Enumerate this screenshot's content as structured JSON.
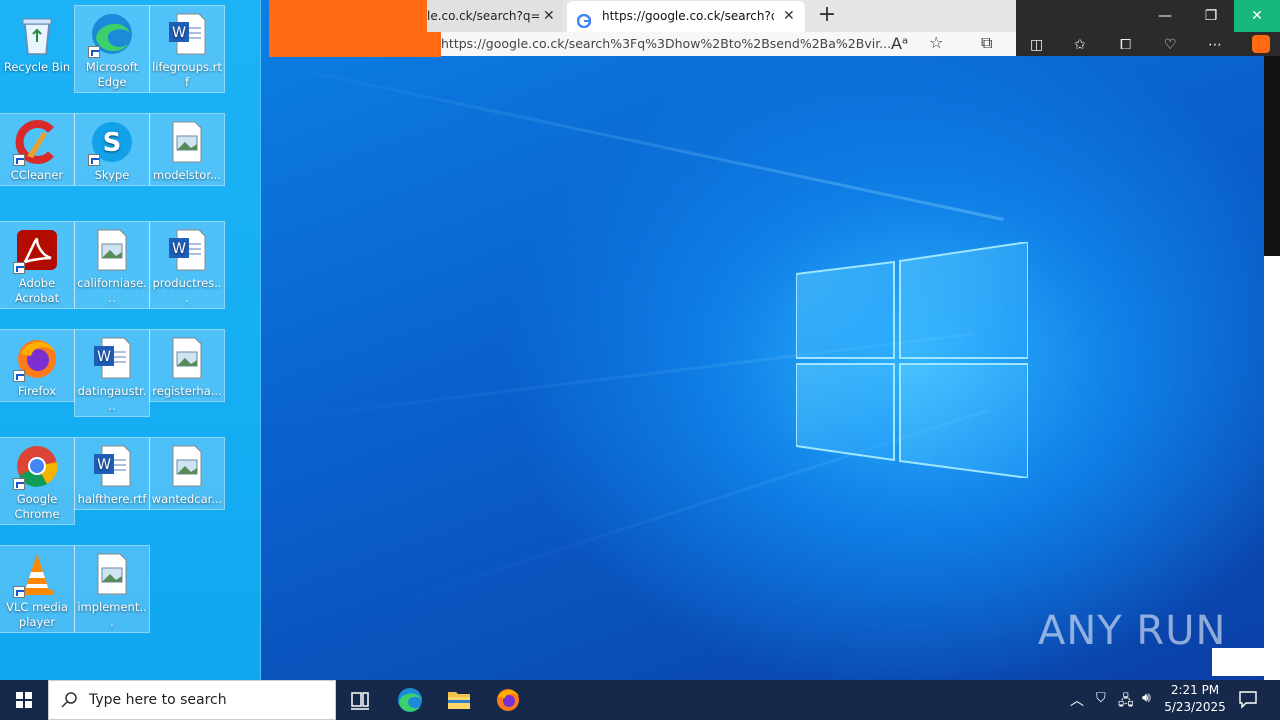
{
  "desktop": {
    "icons": [
      {
        "label": "Recycle Bin"
      },
      {
        "label": "Microsoft Edge"
      },
      {
        "label": "lifegroups.rtf"
      },
      {
        "label": "CCleaner"
      },
      {
        "label": "Skype"
      },
      {
        "label": "modelstor..."
      },
      {
        "label": "Adobe Acrobat"
      },
      {
        "label": "californiase..."
      },
      {
        "label": "productres..."
      },
      {
        "label": "Firefox"
      },
      {
        "label": "datingaustr..."
      },
      {
        "label": "registerha..."
      },
      {
        "label": "Google Chrome"
      },
      {
        "label": "halfthere.rtf"
      },
      {
        "label": "wantedcar..."
      },
      {
        "label": "VLC media player"
      },
      {
        "label": "implement..."
      }
    ]
  },
  "browser": {
    "tab1_title": "le.co.ck/search?q=g",
    "tab2_title": "https://google.co.ck/search?q=h",
    "address": "https://google.co.ck/search%3Fq%3Dhow%2Bto%2Bsend%2Ba%2Bvir..."
  },
  "watermark": "ANY RUN",
  "taskbar": {
    "search_placeholder": "Type here to search",
    "time": "2:21 PM",
    "date": "5/23/2025"
  }
}
